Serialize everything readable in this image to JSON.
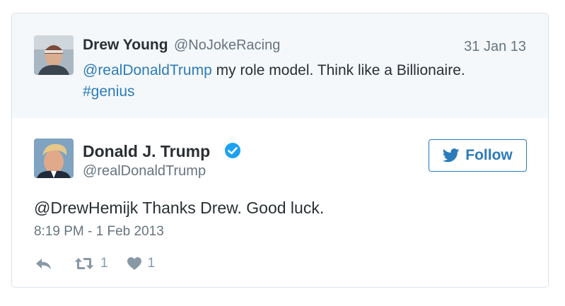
{
  "quoted_tweet": {
    "author_name": "Drew Young",
    "author_handle": "@NoJokeRacing",
    "date": "31 Jan 13",
    "mention": "@realDonaldTrump",
    "text": " my role model. Think like a Billionaire.",
    "hashtag": "#genius"
  },
  "main_tweet": {
    "author_name": "Donald J. Trump",
    "author_handle": "@realDonaldTrump",
    "follow_label": "Follow",
    "text": "@DrewHemijk Thanks Drew. Good luck.",
    "timestamp": "8:19 PM - 1 Feb 2013",
    "retweet_count": "1",
    "like_count": "1"
  },
  "colors": {
    "link": "#2b7bb9",
    "muted": "#66757f",
    "icon": "#8899a6",
    "quoted_bg": "#f5f8fa",
    "verified": "#1da1f2"
  },
  "icons": [
    "reply-icon",
    "retweet-icon",
    "heart-icon",
    "bird-icon",
    "verified-badge-icon"
  ]
}
